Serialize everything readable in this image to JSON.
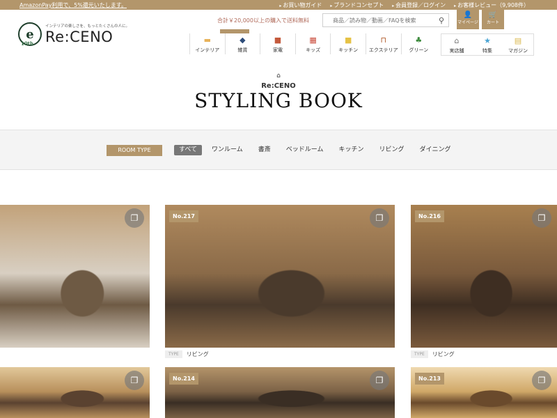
{
  "topbar": {
    "promo": "AmazonPay利用で、5%還元いたします。",
    "links": [
      "お買い物ガイド",
      "ブランドコンセプト",
      "会員登録／ログイン",
      "お客様レビュー（9,908件）"
    ]
  },
  "brand": {
    "tagline": "インテリアの楽しさを、もっとたくさんの人に。",
    "name": "Re:CENO",
    "mark": "e",
    "anniv": "10th"
  },
  "header": {
    "shipping_note": "合計￥20,000以上の購入で送料無料",
    "search_placeholder": "商品／読み物／動画／FAQを検索",
    "mypage": "マイページ",
    "cart": "カート"
  },
  "categories": [
    {
      "label": "インテリア",
      "icon": "lamp-icon",
      "glyph": "▬",
      "color": "#e8b25a"
    },
    {
      "label": "雑貨",
      "icon": "cushion-icon",
      "glyph": "◆",
      "color": "#2e4d7a"
    },
    {
      "label": "家電",
      "icon": "appliance-icon",
      "glyph": "■",
      "color": "#c45a3c"
    },
    {
      "label": "キッズ",
      "icon": "kids-icon",
      "glyph": "▦",
      "color": "#c94a3a"
    },
    {
      "label": "キッチン",
      "icon": "mug-icon",
      "glyph": "■",
      "color": "#e6c245"
    },
    {
      "label": "エクステリア",
      "icon": "bench-icon",
      "glyph": "⊓",
      "color": "#b05a2a"
    },
    {
      "label": "グリーン",
      "icon": "plant-icon",
      "glyph": "♣",
      "color": "#3c8a3c"
    }
  ],
  "categories2": [
    {
      "label": "実店舗",
      "icon": "store-icon",
      "glyph": "⌂",
      "color": "#777"
    },
    {
      "label": "特集",
      "icon": "star-icon",
      "glyph": "★",
      "color": "#4aa4d4"
    },
    {
      "label": "マガジン",
      "icon": "magazine-icon",
      "glyph": "▤",
      "color": "#d9b74a"
    }
  ],
  "hero": {
    "small": "Re:CENO",
    "title": "STYLING BOOK"
  },
  "filter": {
    "label": "ROOM TYPE",
    "options": [
      "すべて",
      "ワンルーム",
      "書斎",
      "ベッドルーム",
      "キッチン",
      "リビング",
      "ダイニング"
    ],
    "active": "すべて"
  },
  "cards": [
    {
      "num": "",
      "type_label": "",
      "type": "",
      "palette": [
        "#d8cfc2",
        "#6e5a44",
        "#c2a27a"
      ]
    },
    {
      "num": "No.217",
      "type_label": "TYPE",
      "type": "リビング",
      "palette": [
        "#8a6a48",
        "#4a3a2c",
        "#b08a5e"
      ]
    },
    {
      "num": "No.216",
      "type_label": "TYPE",
      "type": "リビング",
      "palette": [
        "#7a5a3c",
        "#3e2e22",
        "#a8804f"
      ]
    },
    {
      "num": "",
      "type_label": "",
      "type": "",
      "palette": [
        "#b8905c",
        "#5a4230",
        "#e2c89a"
      ]
    },
    {
      "num": "No.214",
      "type_label": "",
      "type": "",
      "palette": [
        "#7c6246",
        "#3a2e24",
        "#b4946a"
      ]
    },
    {
      "num": "No.213",
      "type_label": "",
      "type": "",
      "palette": [
        "#d0a868",
        "#6a4a2c",
        "#efd9b0"
      ]
    }
  ]
}
